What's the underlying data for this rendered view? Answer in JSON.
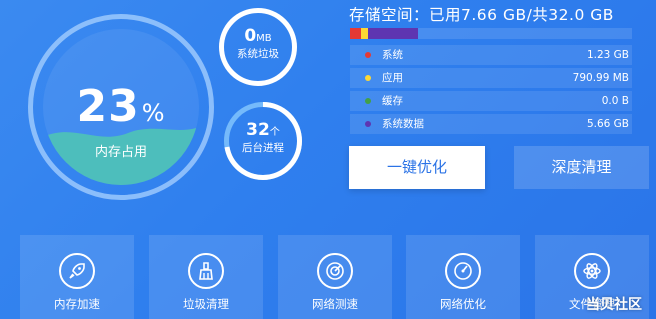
{
  "memory": {
    "value": "23",
    "unit": "%",
    "label": "内存占用",
    "percent": 0.23,
    "wave_color": "#4fc3b6"
  },
  "junk": {
    "value": "0",
    "unit": "MB",
    "label": "系统垃圾"
  },
  "processes": {
    "value": "32",
    "unit": "个",
    "label": "后台进程"
  },
  "storage": {
    "title": "存储空间：已用7.66 GB/共32.0 GB",
    "used_gb": 7.66,
    "total_gb": 32.0,
    "items": [
      {
        "label": "系统",
        "value": "1.23 GB",
        "color": "#e53935",
        "gb": 1.23
      },
      {
        "label": "应用",
        "value": "790.99 MB",
        "color": "#fdd835",
        "gb": 0.77
      },
      {
        "label": "缓存",
        "value": "0.0 B",
        "color": "#43a047",
        "gb": 0.0
      },
      {
        "label": "系统数据",
        "value": "5.66 GB",
        "color": "#5e35b1",
        "gb": 5.66
      }
    ]
  },
  "actions": {
    "optimize": "一键优化",
    "deep_clean": "深度清理"
  },
  "tiles": [
    {
      "label": "内存加速",
      "icon": "rocket-icon"
    },
    {
      "label": "垃圾清理",
      "icon": "broom-icon"
    },
    {
      "label": "网络测速",
      "icon": "radar-icon"
    },
    {
      "label": "网络优化",
      "icon": "speedometer-icon"
    },
    {
      "label": "文件管理",
      "icon": "atom-icon"
    }
  ],
  "watermark": "当贝社区"
}
